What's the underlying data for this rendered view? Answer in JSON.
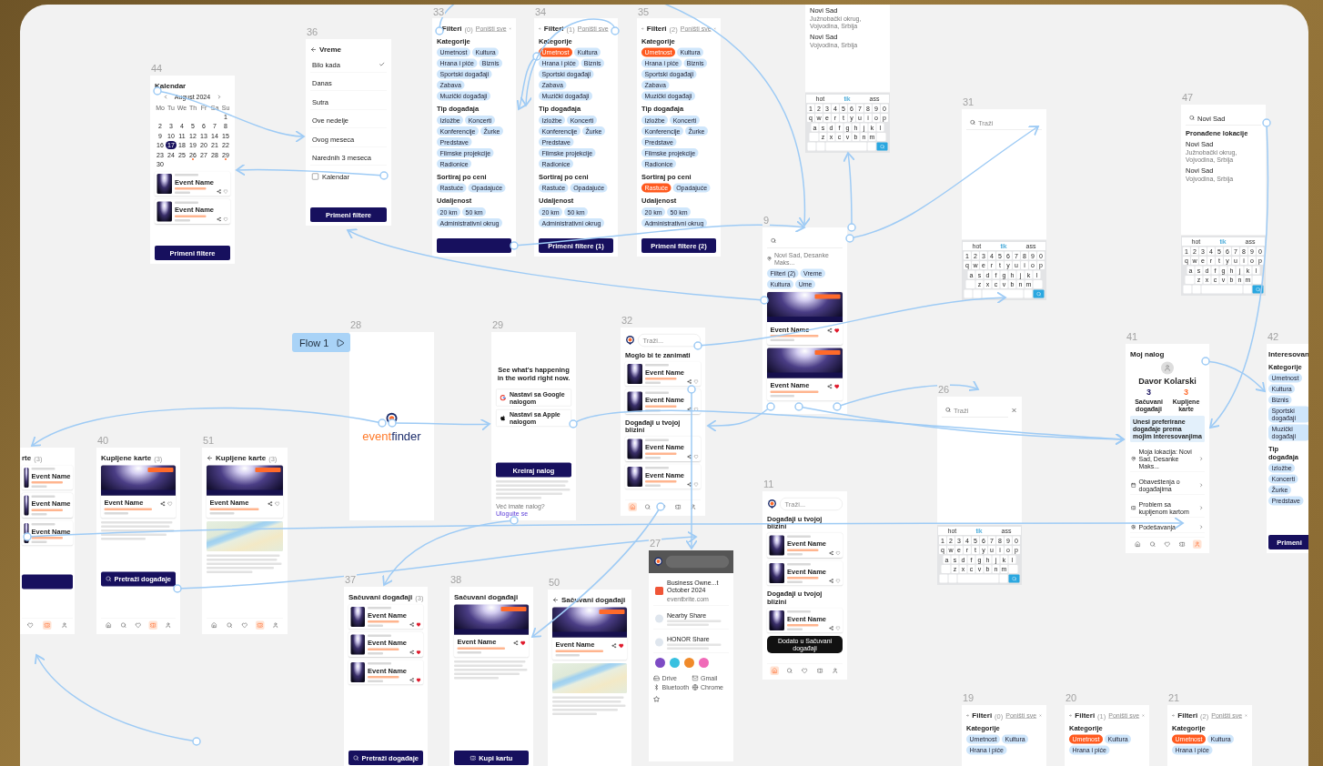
{
  "flow_button": {
    "label": "Flow 1"
  },
  "frames": [
    {
      "number": "33",
      "blocks": [
        {
          "kind": "header",
          "back": true,
          "title": "Filteri",
          "count": "(0)",
          "action": "Poništi sve"
        },
        {
          "kind": "heading",
          "text": "Kategorije"
        },
        {
          "kind": "chips",
          "items": [
            {
              "label": "Umetnost",
              "selected": false
            },
            {
              "label": "Kultura",
              "selected": false
            },
            {
              "label": "Hrana i piće",
              "selected": false
            },
            {
              "label": "Biznis",
              "selected": false
            },
            {
              "label": "Sportski događaji",
              "selected": false
            },
            {
              "label": "Zabava",
              "selected": false
            },
            {
              "label": "Muzički događaji",
              "selected": false
            }
          ]
        },
        {
          "kind": "heading",
          "text": "Tip događaja"
        },
        {
          "kind": "chips",
          "items": [
            {
              "label": "Izložbe",
              "selected": false
            },
            {
              "label": "Koncerti",
              "selected": false
            },
            {
              "label": "Konferencije",
              "selected": false
            },
            {
              "label": "Žurke",
              "selected": false
            },
            {
              "label": "Predstave",
              "selected": false
            },
            {
              "label": "Filmske projekcije",
              "selected": false
            },
            {
              "label": "Radionice",
              "selected": false
            }
          ]
        },
        {
          "kind": "heading",
          "text": "Sortiraj po ceni"
        },
        {
          "kind": "chips",
          "items": [
            {
              "label": "Rastuće",
              "selected": false
            },
            {
              "label": "Opadajuće",
              "selected": false
            }
          ]
        },
        {
          "kind": "heading",
          "text": "Udaljenost"
        },
        {
          "kind": "chips",
          "items": [
            {
              "label": "20 km",
              "selected": false
            },
            {
              "label": "50 km",
              "selected": false
            },
            {
              "label": "Administrativni okrug",
              "selected": false
            }
          ]
        },
        {
          "kind": "button"
        }
      ]
    },
    {
      "number": "34",
      "blocks": [
        {
          "kind": "header",
          "back": true,
          "title": "Filteri",
          "count": "(1)",
          "action": "Poništi sve"
        },
        {
          "kind": "heading",
          "text": "Kategorije"
        },
        {
          "kind": "chips",
          "items": [
            {
              "label": "Umetnost",
              "selected": true
            },
            {
              "label": "Kultura",
              "selected": false
            },
            {
              "label": "Hrana i piće",
              "selected": false
            },
            {
              "label": "Biznis",
              "selected": false
            },
            {
              "label": "Sportski događaji",
              "selected": false
            },
            {
              "label": "Zabava",
              "selected": false
            },
            {
              "label": "Muzički događaji",
              "selected": false
            }
          ]
        },
        {
          "kind": "heading",
          "text": "Tip događaja"
        },
        {
          "kind": "chips",
          "items": [
            {
              "label": "Izložbe",
              "selected": false
            },
            {
              "label": "Koncerti",
              "selected": false
            },
            {
              "label": "Konferencije",
              "selected": false
            },
            {
              "label": "Žurke",
              "selected": false
            },
            {
              "label": "Predstave",
              "selected": false
            },
            {
              "label": "Filmske projekcije",
              "selected": false
            },
            {
              "label": "Radionice",
              "selected": false
            }
          ]
        },
        {
          "kind": "heading",
          "text": "Sortiraj po ceni"
        },
        {
          "kind": "chips",
          "items": [
            {
              "label": "Rastuće",
              "selected": false
            },
            {
              "label": "Opadajuće",
              "selected": false
            }
          ]
        },
        {
          "kind": "heading",
          "text": "Udaljenost"
        },
        {
          "kind": "chips",
          "items": [
            {
              "label": "20 km",
              "selected": false
            },
            {
              "label": "50 km",
              "selected": false
            },
            {
              "label": "Administrativni okrug",
              "selected": false
            }
          ]
        },
        {
          "kind": "button",
          "label": "Primeni filtere (1)"
        }
      ]
    },
    {
      "number": "35",
      "blocks": [
        {
          "kind": "header",
          "back": true,
          "title": "Filteri",
          "count": "(2)",
          "action": "Poništi sve"
        },
        {
          "kind": "heading",
          "text": "Kategorije"
        },
        {
          "kind": "chips",
          "items": [
            {
              "label": "Umetnost",
              "selected": true
            },
            {
              "label": "Kultura",
              "selected": false
            },
            {
              "label": "Hrana i piće",
              "selected": false
            },
            {
              "label": "Biznis",
              "selected": false
            },
            {
              "label": "Sportski događaji",
              "selected": false
            },
            {
              "label": "Zabava",
              "selected": false
            },
            {
              "label": "Muzički događaji",
              "selected": false
            }
          ]
        },
        {
          "kind": "heading",
          "text": "Tip događaja"
        },
        {
          "kind": "chips",
          "items": [
            {
              "label": "Izložbe",
              "selected": false
            },
            {
              "label": "Koncerti",
              "selected": false
            },
            {
              "label": "Konferencije",
              "selected": false
            },
            {
              "label": "Žurke",
              "selected": false
            },
            {
              "label": "Predstave",
              "selected": false
            },
            {
              "label": "Filmske projekcije",
              "selected": false
            },
            {
              "label": "Radionice",
              "selected": false
            }
          ]
        },
        {
          "kind": "heading",
          "text": "Sortiraj po ceni"
        },
        {
          "kind": "chips",
          "items": [
            {
              "label": "Rastuće",
              "selected": true
            },
            {
              "label": "Opadajuće",
              "selected": false
            }
          ]
        },
        {
          "kind": "heading",
          "text": "Udaljenost"
        },
        {
          "kind": "chips",
          "items": [
            {
              "label": "20 km",
              "selected": false
            },
            {
              "label": "50 km",
              "selected": false
            },
            {
              "label": "Administrativni okrug",
              "selected": false
            }
          ]
        },
        {
          "kind": "button",
          "label": "Primeni filtere (2)"
        }
      ]
    },
    {
      "blocks": [
        {
          "kind": "location",
          "name": "Novi Sad",
          "detail": "Južnobački okrug, Vojvodina, Srbija"
        },
        {
          "kind": "location",
          "name": "Novi Sad",
          "detail": "Vojvodina, Srbija"
        },
        {
          "kind": "keyboard",
          "suggestions": [
            "hot",
            "tik",
            "ass"
          ],
          "rows": [
            "1 2 3 4 5 6 7 8 9 0",
            "q w e r t y u i o p",
            "a s d f g h j k l",
            "z x c v b n m"
          ]
        }
      ]
    },
    {
      "number": "44",
      "blocks": [
        {
          "kind": "header",
          "back": false,
          "title": "Kalendar"
        },
        {
          "kind": "calendar",
          "month": "August 2024",
          "weekdays": [
            "Mo",
            "Tu",
            "We",
            "Th",
            "Fr",
            "Sa",
            "Su"
          ],
          "days": [
            {
              "label": "1",
              "selected": false,
              "event": false
            },
            {
              "label": "2",
              "selected": false,
              "event": false
            },
            {
              "label": "3",
              "selected": false,
              "event": false
            },
            {
              "label": "4",
              "selected": false,
              "event": false
            },
            {
              "label": "5",
              "selected": false,
              "event": false
            },
            {
              "label": "6",
              "selected": false,
              "event": false
            },
            {
              "label": "7",
              "selected": false,
              "event": false
            },
            {
              "label": "8",
              "selected": false,
              "event": false
            },
            {
              "label": "9",
              "selected": false,
              "event": false
            },
            {
              "label": "10",
              "selected": false,
              "event": false
            },
            {
              "label": "11",
              "selected": false,
              "event": false
            },
            {
              "label": "12",
              "selected": false,
              "event": false
            },
            {
              "label": "13",
              "selected": false,
              "event": false
            },
            {
              "label": "14",
              "selected": false,
              "event": false
            },
            {
              "label": "15",
              "selected": false,
              "event": false
            },
            {
              "label": "16",
              "selected": false,
              "event": false
            },
            {
              "label": "17",
              "selected": true,
              "event": false
            },
            {
              "label": "18",
              "selected": false,
              "event": false
            },
            {
              "label": "19",
              "selected": false,
              "event": false
            },
            {
              "label": "20",
              "selected": false,
              "event": false
            },
            {
              "label": "21",
              "selected": false,
              "event": false
            },
            {
              "label": "22",
              "selected": false,
              "event": false
            },
            {
              "label": "23",
              "selected": false,
              "event": false
            },
            {
              "label": "24",
              "selected": false,
              "event": false
            },
            {
              "label": "25",
              "selected": false,
              "event": false
            },
            {
              "label": "26",
              "selected": false,
              "event": true
            },
            {
              "label": "27",
              "selected": false,
              "event": false
            },
            {
              "label": "28",
              "selected": false,
              "event": false
            },
            {
              "label": "29",
              "selected": false,
              "event": true
            },
            {
              "label": "30",
              "selected": false,
              "event": false
            }
          ]
        },
        {
          "kind": "event-card",
          "name": "Event Name",
          "saved": false
        },
        {
          "kind": "event-card",
          "name": "Event Name",
          "saved": false
        },
        {
          "kind": "button",
          "label": "Primeni filtere"
        }
      ]
    },
    {
      "number": "36",
      "blocks": [
        {
          "kind": "header",
          "back": true,
          "title": "Vreme"
        },
        {
          "kind": "option",
          "label": "Bilo kada",
          "checked": true
        },
        {
          "kind": "option",
          "label": "Danas",
          "checked": false
        },
        {
          "kind": "option",
          "label": "Sutra",
          "checked": false
        },
        {
          "kind": "option",
          "label": "Ove nedelje",
          "checked": false
        },
        {
          "kind": "option",
          "label": "Ovog meseca",
          "checked": false
        },
        {
          "kind": "option",
          "label": "Narednih 3 meseca",
          "checked": false
        },
        {
          "kind": "checkbox",
          "label": "Kalendar",
          "checked": false
        },
        {
          "kind": "button",
          "label": "Primeni filtere"
        }
      ]
    },
    {
      "number": "31",
      "blocks": [
        {
          "kind": "search",
          "placeholder": "Traži"
        },
        {
          "kind": "keyboard",
          "suggestions": [
            "hot",
            "tik",
            "ass"
          ],
          "rows": [
            "1 2 3 4 5 6 7 8 9 0",
            "q w e r t y u i o p",
            "a s d f g h j k l",
            "z x c v b n m"
          ]
        }
      ]
    },
    {
      "number": "47",
      "blocks": [
        {
          "kind": "search",
          "value": "Novi Sad"
        },
        {
          "kind": "heading",
          "text": "Pronađene lokacije"
        },
        {
          "kind": "location",
          "name": "Novi Sad",
          "detail": "Južnobački okrug, Vojvodina, Srbija"
        },
        {
          "kind": "location",
          "name": "Novi Sad",
          "detail": "Vojvodina, Srbija"
        },
        {
          "kind": "keyboard",
          "suggestions": [
            "hot",
            "tik",
            "ass"
          ],
          "rows": [
            "1 2 3 4 5 6 7 8 9 0",
            "q w e r t y u i o p",
            "a s d f g h j k l",
            "z x c v b n m"
          ]
        }
      ]
    },
    {
      "number": "9",
      "blocks": [
        {
          "kind": "search"
        },
        {
          "kind": "pin-row",
          "text": "Novi Sad, Desanke Maks..."
        },
        {
          "kind": "chips",
          "items": [
            {
              "label": "Filteri (2)",
              "selected": false
            },
            {
              "label": "Vreme",
              "selected": false
            },
            {
              "label": "Kultura",
              "selected": false
            },
            {
              "label": "Ume",
              "selected": false
            }
          ]
        },
        {
          "kind": "event-hero",
          "name": "Event Name",
          "saved": true
        },
        {
          "kind": "event-hero",
          "name": "Event Name",
          "saved": true
        }
      ]
    },
    {
      "number": "28",
      "blocks": [
        {
          "kind": "logo",
          "parts": [
            "event",
            "finder"
          ]
        }
      ]
    },
    {
      "number": "29",
      "blocks": [
        {
          "kind": "headline",
          "text": "See what's happening in the world right now."
        },
        {
          "kind": "google-button",
          "label": "Nastavi sa Google nalogom"
        },
        {
          "kind": "apple-button",
          "label": "Nastavi sa Apple nalogom"
        },
        {
          "kind": "button",
          "label": "Kreiraj nalog"
        },
        {
          "kind": "paragraph"
        },
        {
          "kind": "signin",
          "text": "Već imate nalog?",
          "link": "Uloguite se"
        }
      ]
    },
    {
      "number": "32",
      "blocks": [
        {
          "kind": "search",
          "logo": true,
          "placeholder": "Traži..."
        },
        {
          "kind": "heading",
          "text": "Moglo bi te zanimati"
        },
        {
          "kind": "event-card",
          "name": "Event Name",
          "saved": false
        },
        {
          "kind": "event-card",
          "name": "Event Name",
          "saved": false
        },
        {
          "kind": "heading",
          "text": "Događaji u tvojoj blizini"
        },
        {
          "kind": "event-card",
          "name": "Event Name",
          "saved": false
        },
        {
          "kind": "event-card",
          "name": "Event Name",
          "saved": false
        },
        {
          "kind": "tabbar",
          "tabs": [
            {
              "kind": "home",
              "selected": true
            },
            {
              "kind": "search",
              "selected": false
            },
            {
              "kind": "heart",
              "selected": false
            },
            {
              "kind": "ticket",
              "selected": false
            },
            {
              "kind": "user",
              "selected": false
            }
          ]
        }
      ]
    },
    {
      "number": "26",
      "blocks": [
        {
          "kind": "search",
          "placeholder": "Traži",
          "close": true
        },
        {
          "kind": "keyboard",
          "suggestions": [
            "hot",
            "tik",
            "ass"
          ],
          "rows": [
            "1 2 3 4 5 6 7 8 9 0",
            "q w e r t y u i o p",
            "a s d f g h j k l",
            "z x c v b n m"
          ]
        }
      ]
    },
    {
      "number": "41",
      "blocks": [
        {
          "kind": "header",
          "back": false,
          "title": "Moj nalog"
        },
        {
          "kind": "profile",
          "name": "Davor Kolarski",
          "stats": [
            {
              "value": "3",
              "label": "Sačuvani događaji"
            },
            {
              "value": "3",
              "label": "Kupljene karte"
            }
          ]
        },
        {
          "kind": "banner",
          "text": "Unesi preferirane događaje prema mojim interesovanjima"
        },
        {
          "kind": "menu-row",
          "label": "Moja lokacija: Novi Sad, Desanke Maks..."
        },
        {
          "kind": "menu-row",
          "label": "Obaveštenja o događajima"
        },
        {
          "kind": "menu-row",
          "label": "Problem sa kupljenom kartom"
        },
        {
          "kind": "menu-row",
          "label": "Podešavanja"
        },
        {
          "kind": "tabbar",
          "tabs": [
            {
              "kind": "home",
              "selected": false
            },
            {
              "kind": "search",
              "selected": false
            },
            {
              "kind": "heart",
              "selected": false
            },
            {
              "kind": "ticket",
              "selected": false
            },
            {
              "kind": "user",
              "selected": true
            }
          ]
        }
      ]
    },
    {
      "number": "42",
      "blocks": [
        {
          "kind": "header",
          "back": false,
          "title": "Interesovan"
        },
        {
          "kind": "heading",
          "text": "Kategorije"
        },
        {
          "kind": "chips",
          "items": [
            {
              "label": "Umetnost",
              "selected": false
            },
            {
              "label": "Kultura",
              "selected": false
            },
            {
              "label": "Biznis",
              "selected": false
            },
            {
              "label": "Sportski događaji",
              "selected": false
            },
            {
              "label": "Muzički događaji",
              "selected": false
            }
          ]
        },
        {
          "kind": "heading",
          "text": "Tip događaja"
        },
        {
          "kind": "chips",
          "items": [
            {
              "label": "Izložbe",
              "selected": false
            },
            {
              "label": "Koncerti",
              "selected": false
            },
            {
              "label": "Žurke",
              "selected": false
            },
            {
              "label": "Predstave",
              "selected": false
            }
          ]
        },
        {
          "kind": "button",
          "label": "Primeni"
        }
      ]
    },
    {
      "blocks": [
        {
          "kind": "header",
          "back": false,
          "title": "rte",
          "count": "(3)"
        },
        {
          "kind": "event-card",
          "name": "Event Name"
        },
        {
          "kind": "event-card",
          "name": "Event Name"
        },
        {
          "kind": "event-card",
          "name": "Event Name"
        },
        {
          "kind": "button"
        },
        {
          "kind": "tabbar",
          "tabs": [
            {
              "kind": "heart",
              "selected": false
            },
            {
              "kind": "ticket",
              "selected": true
            },
            {
              "kind": "user",
              "selected": false
            }
          ]
        }
      ]
    },
    {
      "number": "40",
      "blocks": [
        {
          "kind": "header",
          "back": false,
          "title": "Kupljene karte",
          "count": "(3)"
        },
        {
          "kind": "event-hero",
          "name": "Event Name",
          "saved": false
        },
        {
          "kind": "paragraph"
        },
        {
          "kind": "search-button",
          "label": "Pretraži događaje"
        },
        {
          "kind": "tabbar",
          "tabs": [
            {
              "kind": "home",
              "selected": false
            },
            {
              "kind": "search",
              "selected": false
            },
            {
              "kind": "heart",
              "selected": false
            },
            {
              "kind": "ticket",
              "selected": true
            },
            {
              "kind": "user",
              "selected": false
            }
          ]
        }
      ]
    },
    {
      "number": "51",
      "blocks": [
        {
          "kind": "header",
          "back": true,
          "title": "Kupljene karte",
          "count": "(3)"
        },
        {
          "kind": "event-hero",
          "name": "Event Name",
          "saved": false
        },
        {
          "kind": "map"
        },
        {
          "kind": "paragraph"
        },
        {
          "kind": "tabbar",
          "tabs": [
            {
              "kind": "home",
              "selected": false
            },
            {
              "kind": "search",
              "selected": false
            },
            {
              "kind": "heart",
              "selected": false
            },
            {
              "kind": "ticket",
              "selected": true
            },
            {
              "kind": "user",
              "selected": false
            }
          ]
        }
      ]
    },
    {
      "number": "11",
      "blocks": [
        {
          "kind": "search",
          "logo": true,
          "placeholder": "Traži..."
        },
        {
          "kind": "heading",
          "text": "Događaji u tvojoj blizini"
        },
        {
          "kind": "event-card",
          "name": "Event Name",
          "saved": false
        },
        {
          "kind": "event-card",
          "name": "Event Name",
          "saved": false
        },
        {
          "kind": "heading",
          "text": "Događaji u tvojoj blizini"
        },
        {
          "kind": "event-card",
          "name": "Event Name",
          "saved": false
        },
        {
          "kind": "toast",
          "text": "Dodato u Sačuvani događaji"
        },
        {
          "kind": "tabbar",
          "tabs": [
            {
              "kind": "home",
              "selected": true
            },
            {
              "kind": "search",
              "selected": false
            },
            {
              "kind": "heart",
              "selected": false
            },
            {
              "kind": "ticket",
              "selected": false
            },
            {
              "kind": "user",
              "selected": false
            }
          ]
        }
      ]
    },
    {
      "number": "27",
      "blocks": [
        {
          "kind": "dim-search"
        },
        {
          "kind": "share-link",
          "title": "Business Owne...t October 2024",
          "url": "eventbrite.com"
        },
        {
          "kind": "share-option",
          "title": "Nearby Share"
        },
        {
          "kind": "share-option",
          "title": "HONOR Share"
        },
        {
          "kind": "contacts"
        },
        {
          "kind": "apps",
          "items": [
            {
              "kind": "drive",
              "label": "Drive"
            },
            {
              "kind": "mail",
              "label": "Gmail"
            },
            {
              "kind": "bluetooth",
              "label": "Bluetooth"
            },
            {
              "kind": "globe",
              "label": "Chrome"
            }
          ]
        },
        {
          "kind": "favorite"
        }
      ]
    },
    {
      "number": "37",
      "blocks": [
        {
          "kind": "header",
          "back": false,
          "title": "Sačuvani događaji",
          "count": "(3)"
        },
        {
          "kind": "event-card",
          "name": "Event Name",
          "saved": true
        },
        {
          "kind": "event-card",
          "name": "Event Name",
          "saved": true
        },
        {
          "kind": "event-card",
          "name": "Event Name",
          "saved": true
        },
        {
          "kind": "search-button",
          "label": "Pretraži događaje"
        }
      ]
    },
    {
      "number": "38",
      "blocks": [
        {
          "kind": "header",
          "back": false,
          "title": "Sačuvani događaji"
        },
        {
          "kind": "event-hero",
          "name": "Event Name",
          "saved": true
        },
        {
          "kind": "paragraph"
        },
        {
          "kind": "ticket-button",
          "label": "Kupi kartu"
        }
      ]
    },
    {
      "number": "50",
      "blocks": [
        {
          "kind": "header",
          "back": true,
          "title": "Sačuvani događaji"
        },
        {
          "kind": "event-hero",
          "name": "Event Name",
          "saved": true
        },
        {
          "kind": "map"
        },
        {
          "kind": "paragraph"
        }
      ]
    },
    {
      "number": "19",
      "blocks": [
        {
          "kind": "header",
          "back": true,
          "title": "Filteri",
          "count": "(0)",
          "action": "Poništi sve"
        },
        {
          "kind": "heading",
          "text": "Kategorije"
        },
        {
          "kind": "chips",
          "items": [
            {
              "label": "Umetnost",
              "selected": false
            },
            {
              "label": "Kultura",
              "selected": false
            },
            {
              "label": "Hrana i piće",
              "selected": false
            }
          ]
        }
      ]
    },
    {
      "number": "20",
      "blocks": [
        {
          "kind": "header",
          "back": true,
          "title": "Filteri",
          "count": "(1)",
          "action": "Poništi sve"
        },
        {
          "kind": "heading",
          "text": "Kategorije"
        },
        {
          "kind": "chips",
          "items": [
            {
              "label": "Umetnost",
              "selected": true
            },
            {
              "label": "Kultura",
              "selected": false
            },
            {
              "label": "Hrana i piće",
              "selected": false
            }
          ]
        }
      ]
    },
    {
      "number": "21",
      "blocks": [
        {
          "kind": "header",
          "back": true,
          "title": "Filteri",
          "count": "(2)",
          "action": "Poništi sve"
        },
        {
          "kind": "heading",
          "text": "Kategorije"
        },
        {
          "kind": "chips",
          "items": [
            {
              "label": "Umetnost",
              "selected": true
            },
            {
              "label": "Kultura",
              "selected": false
            },
            {
              "label": "Hrana i piće",
              "selected": false
            }
          ]
        }
      ]
    }
  ]
}
